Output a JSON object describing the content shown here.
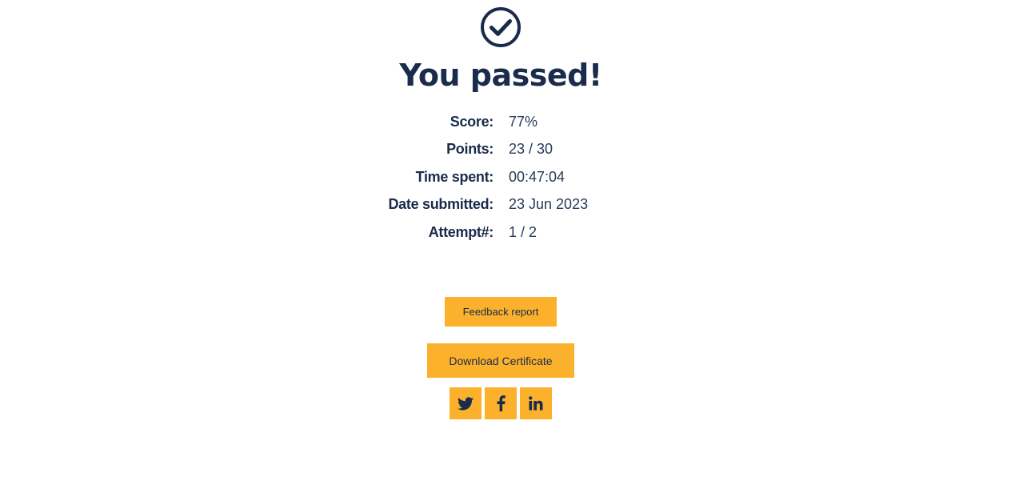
{
  "header": {
    "icon": "check-circle-icon",
    "title": "You passed!"
  },
  "stats": [
    {
      "label": "Score:",
      "value": "77%"
    },
    {
      "label": "Points:",
      "value": "23 / 30"
    },
    {
      "label": "Time spent:",
      "value": "00:47:04"
    },
    {
      "label": "Date submitted:",
      "value": "23 Jun 2023"
    },
    {
      "label": "Attempt#:",
      "value": "1 / 2"
    }
  ],
  "actions": {
    "feedback_label": "Feedback report",
    "certificate_label": "Download Certificate"
  },
  "share": [
    {
      "icon": "twitter-icon"
    },
    {
      "icon": "facebook-icon"
    },
    {
      "icon": "linkedin-icon"
    }
  ],
  "colors": {
    "primary_text": "#1b2b4b",
    "accent": "#fbb12b",
    "background": "#ffffff"
  }
}
